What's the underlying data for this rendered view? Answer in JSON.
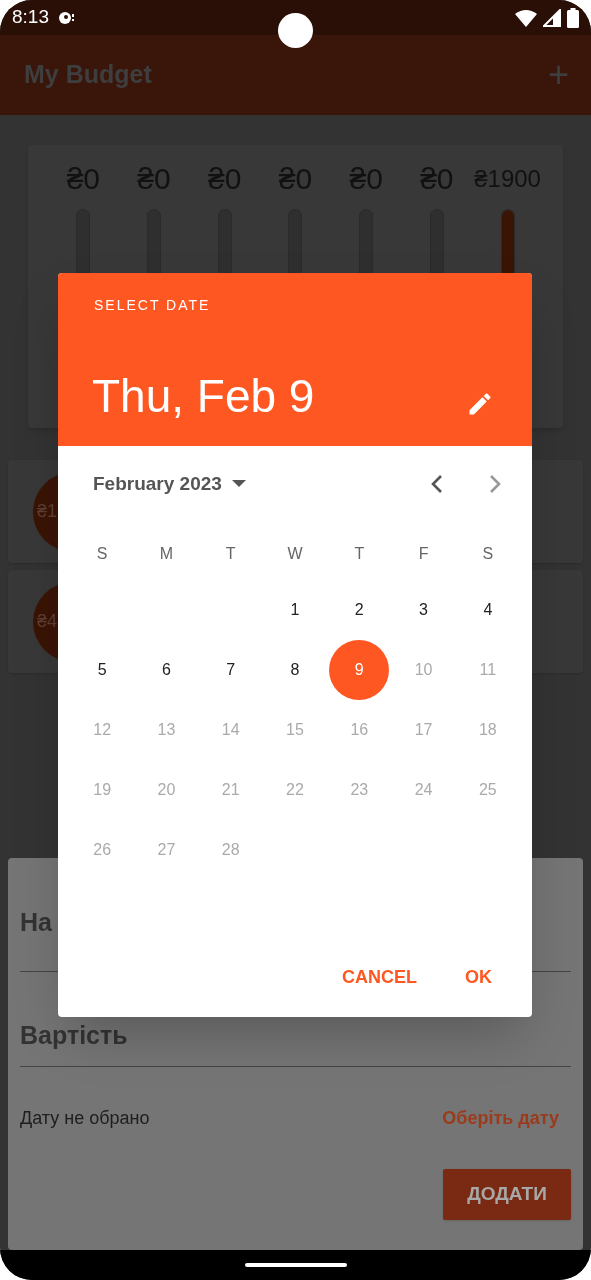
{
  "status_bar": {
    "time": "8:13"
  },
  "app_bar": {
    "title": "My Budget",
    "add_button": "+"
  },
  "chart": {
    "bars": [
      {
        "amount": "₴0",
        "level": 0
      },
      {
        "amount": "₴0",
        "level": 0
      },
      {
        "amount": "₴0",
        "level": 0
      },
      {
        "amount": "₴0",
        "level": 0
      },
      {
        "amount": "₴0",
        "level": 0
      },
      {
        "amount": "₴0",
        "level": 0
      },
      {
        "amount": "₴1900",
        "level": 1
      }
    ]
  },
  "transactions": [
    {
      "amount": "₴1"
    },
    {
      "amount": "₴4"
    }
  ],
  "form": {
    "name_label": "На",
    "cost_label": "Вартість",
    "date_status": "Дату не обрано",
    "pick_date_button": "Оберіть дату",
    "add_button": "ДОДАТИ"
  },
  "date_picker": {
    "header_label": "SELECT DATE",
    "selected_date": "Thu, Feb 9",
    "month_label": "February 2023",
    "weekdays": [
      "S",
      "M",
      "T",
      "W",
      "T",
      "F",
      "S"
    ],
    "weeks": [
      {
        "kind": "leading",
        "days": [
          {
            "label": "1",
            "disabled": false,
            "selected": false
          },
          {
            "label": "2",
            "disabled": false,
            "selected": false
          },
          {
            "label": "3",
            "disabled": false,
            "selected": false
          },
          {
            "label": "4",
            "disabled": false,
            "selected": false
          }
        ]
      },
      {
        "kind": "full",
        "days": [
          {
            "label": "5",
            "disabled": false,
            "selected": false
          },
          {
            "label": "6",
            "disabled": false,
            "selected": false
          },
          {
            "label": "7",
            "disabled": false,
            "selected": false
          },
          {
            "label": "8",
            "disabled": false,
            "selected": false
          },
          {
            "label": "9",
            "disabled": false,
            "selected": true
          },
          {
            "label": "10",
            "disabled": true,
            "selected": false
          },
          {
            "label": "11",
            "disabled": true,
            "selected": false
          }
        ]
      },
      {
        "kind": "full",
        "days": [
          {
            "label": "12",
            "disabled": true,
            "selected": false
          },
          {
            "label": "13",
            "disabled": true,
            "selected": false
          },
          {
            "label": "14",
            "disabled": true,
            "selected": false
          },
          {
            "label": "15",
            "disabled": true,
            "selected": false
          },
          {
            "label": "16",
            "disabled": true,
            "selected": false
          },
          {
            "label": "17",
            "disabled": true,
            "selected": false
          },
          {
            "label": "18",
            "disabled": true,
            "selected": false
          }
        ]
      },
      {
        "kind": "full",
        "days": [
          {
            "label": "19",
            "disabled": true,
            "selected": false
          },
          {
            "label": "20",
            "disabled": true,
            "selected": false
          },
          {
            "label": "21",
            "disabled": true,
            "selected": false
          },
          {
            "label": "22",
            "disabled": true,
            "selected": false
          },
          {
            "label": "23",
            "disabled": true,
            "selected": false
          },
          {
            "label": "24",
            "disabled": true,
            "selected": false
          },
          {
            "label": "25",
            "disabled": true,
            "selected": false
          }
        ]
      },
      {
        "kind": "trailing",
        "days": [
          {
            "label": "26",
            "disabled": true,
            "selected": false
          },
          {
            "label": "27",
            "disabled": true,
            "selected": false
          },
          {
            "label": "28",
            "disabled": true,
            "selected": false
          }
        ]
      }
    ],
    "buttons": [
      {
        "label": "CANCEL"
      },
      {
        "label": "OK"
      }
    ]
  }
}
